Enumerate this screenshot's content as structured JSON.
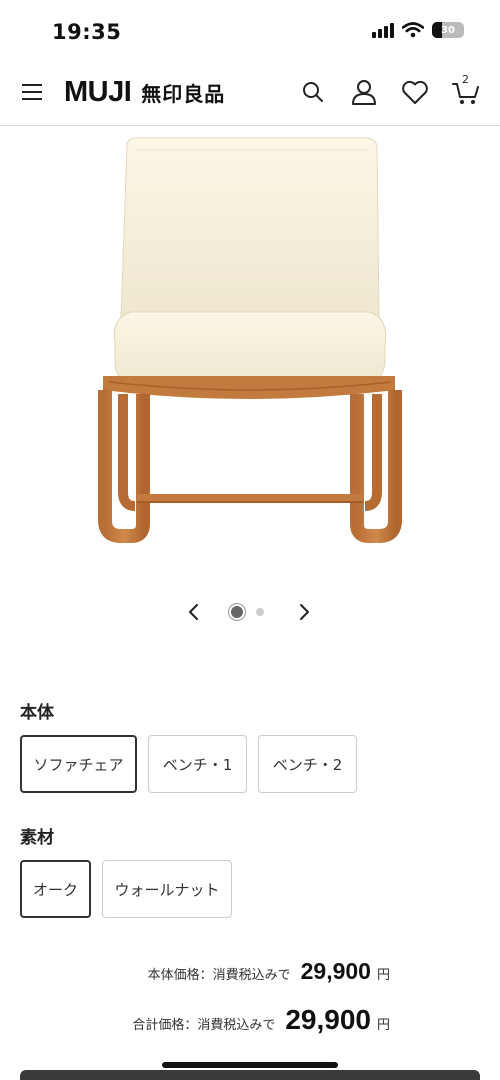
{
  "status_bar": {
    "time": "19:35",
    "battery": "30",
    "battery_level_percent": 30,
    "icons": [
      "signal-icon",
      "wifi-icon",
      "battery-icon"
    ]
  },
  "header": {
    "logo_latin": "MUJI",
    "logo_kanji": "無印良品",
    "cart_count": "2",
    "icons": [
      "menu-icon",
      "search-icon",
      "account-icon",
      "heart-icon",
      "cart-icon"
    ]
  },
  "product": {
    "image": "chair-image",
    "carousel": {
      "current": 1,
      "total": 2,
      "icons": [
        "chevron-left-icon",
        "chevron-right-icon"
      ]
    }
  },
  "variants": {
    "body": {
      "label": "本体",
      "options": [
        "ソファチェア",
        "ベンチ・1",
        "ベンチ・2"
      ],
      "selected": "ソファチェア"
    },
    "material": {
      "label": "素材",
      "options": [
        "オーク",
        "ウォールナット"
      ],
      "selected": "オーク"
    }
  },
  "pricing": {
    "base_label": "本体価格：消費税込みで",
    "base_value": "29,900",
    "total_label": "合計価格：消費税込みで",
    "total_value": "29,900",
    "currency": "円"
  },
  "colors": {
    "text": "#222222",
    "border": "#cccccc",
    "selected_border": "#333333",
    "cushion": "#f6f0dc",
    "wood": "#c27a3e"
  }
}
